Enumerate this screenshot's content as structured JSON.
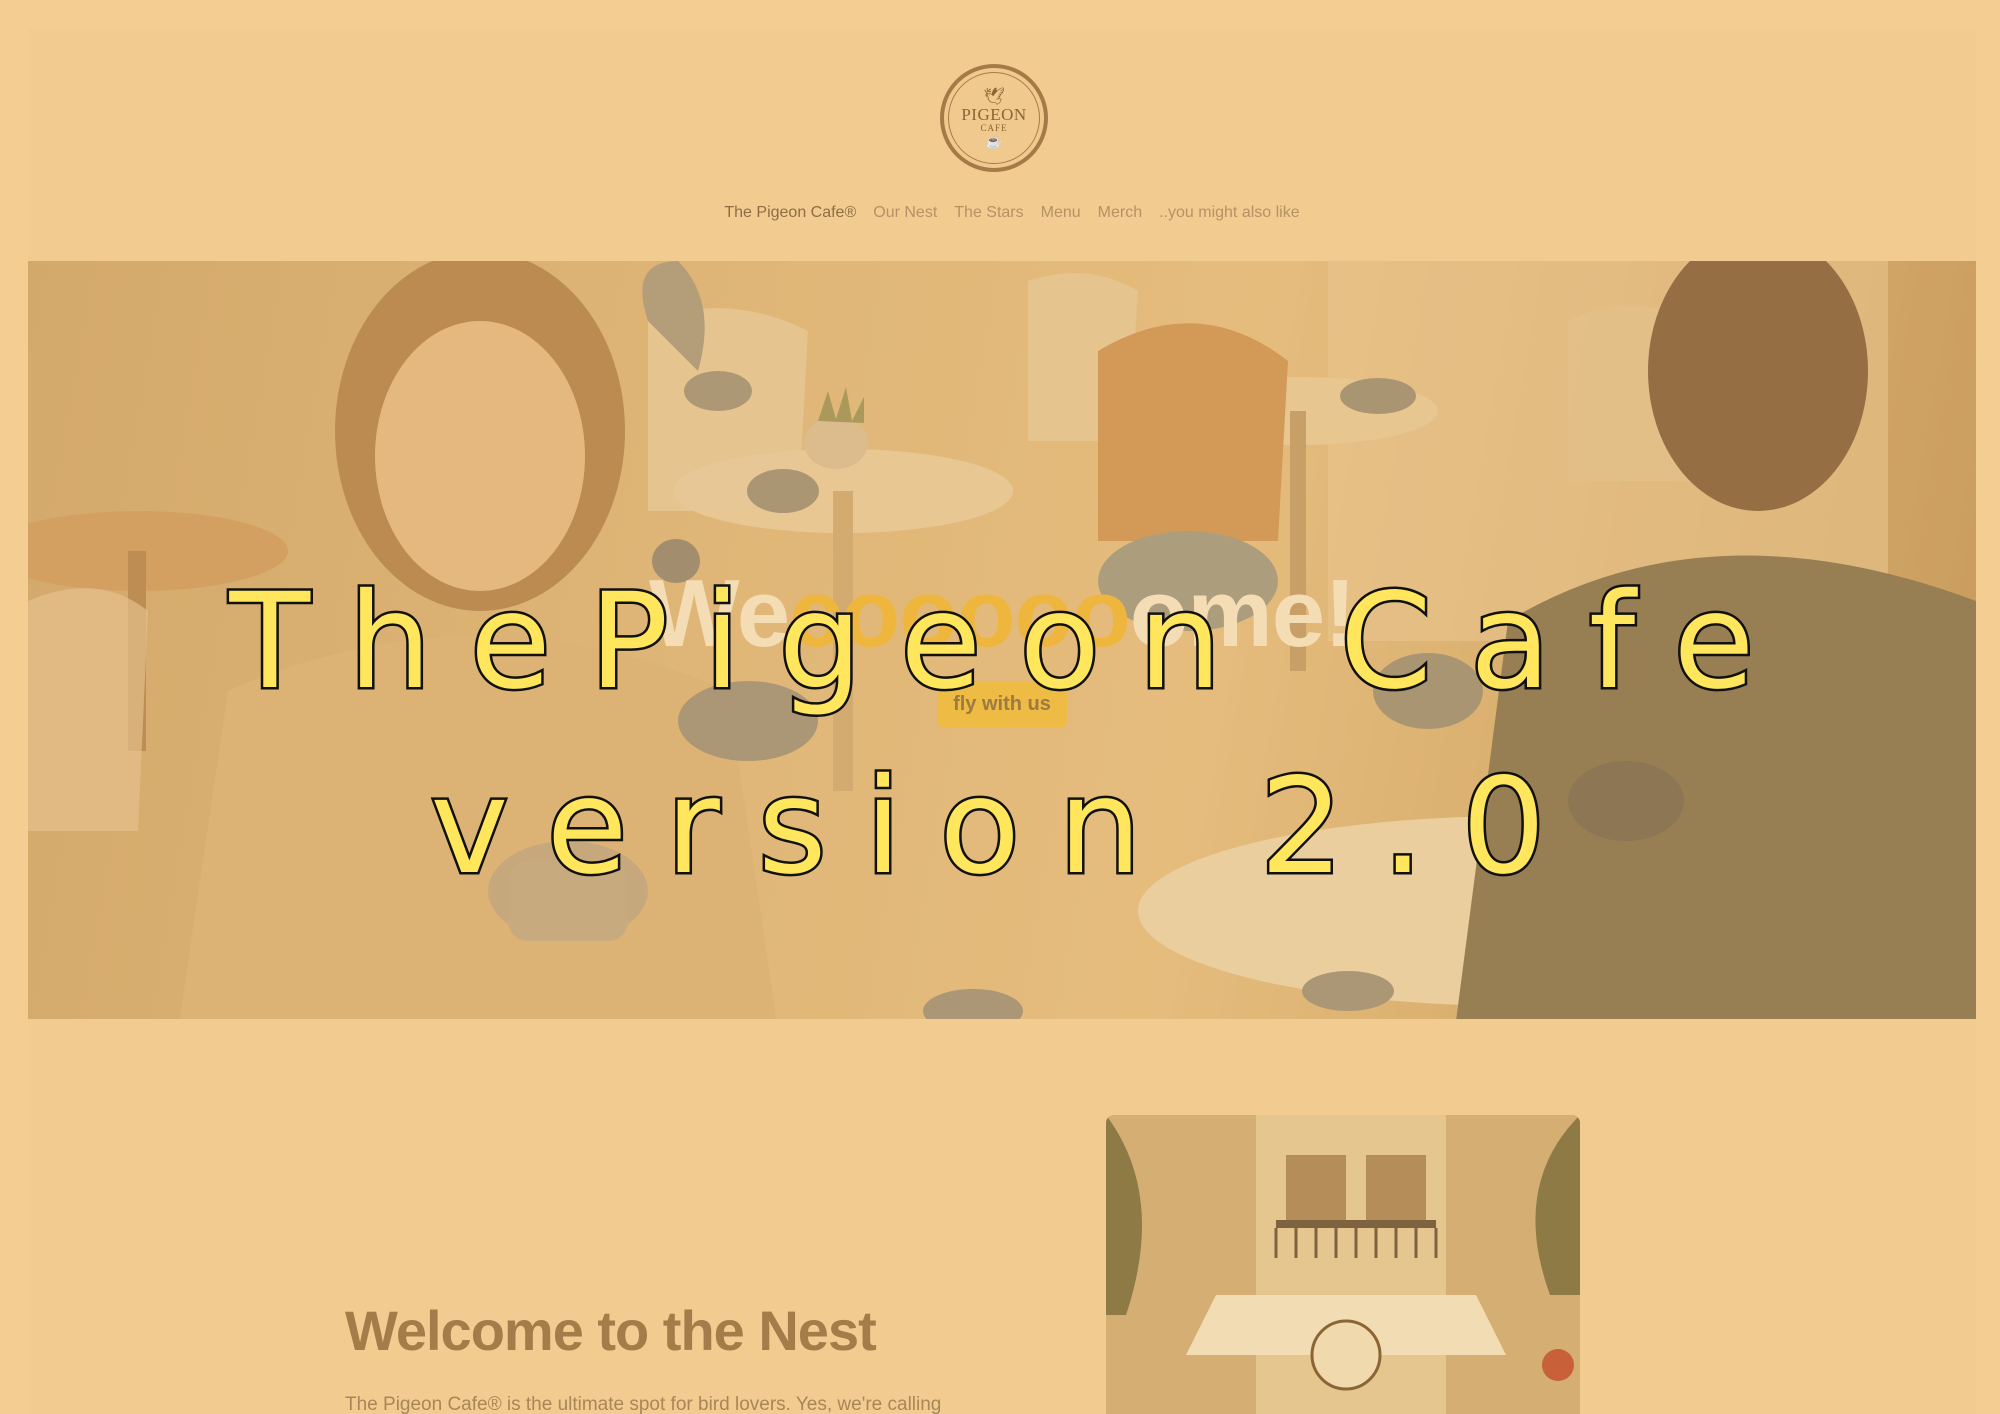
{
  "logo": {
    "word": "PIGEON",
    "sub": "CAFE"
  },
  "nav": {
    "items": [
      {
        "label": "The Pigeon Cafe®",
        "active": true
      },
      {
        "label": "Our Nest",
        "active": false
      },
      {
        "label": "The Stars",
        "active": false
      },
      {
        "label": "Menu",
        "active": false
      },
      {
        "label": "Merch",
        "active": false
      },
      {
        "label": "..you might also like",
        "active": false
      }
    ]
  },
  "hero": {
    "title_start": "We",
    "title_highlight": "cooooo",
    "title_end": "ome!",
    "button_label": "fly with us"
  },
  "overlay": {
    "line1": "ThePigeon Cafe",
    "line2": "version 2.0"
  },
  "nest": {
    "title": "Welcome to the Nest",
    "body": "The Pigeon Cafe® is the ultimate spot for bird lovers. Yes, we're calling"
  },
  "colors": {
    "background": "#f3cd91",
    "accent": "#eebb45",
    "overlay_text": "#ffe65c"
  }
}
